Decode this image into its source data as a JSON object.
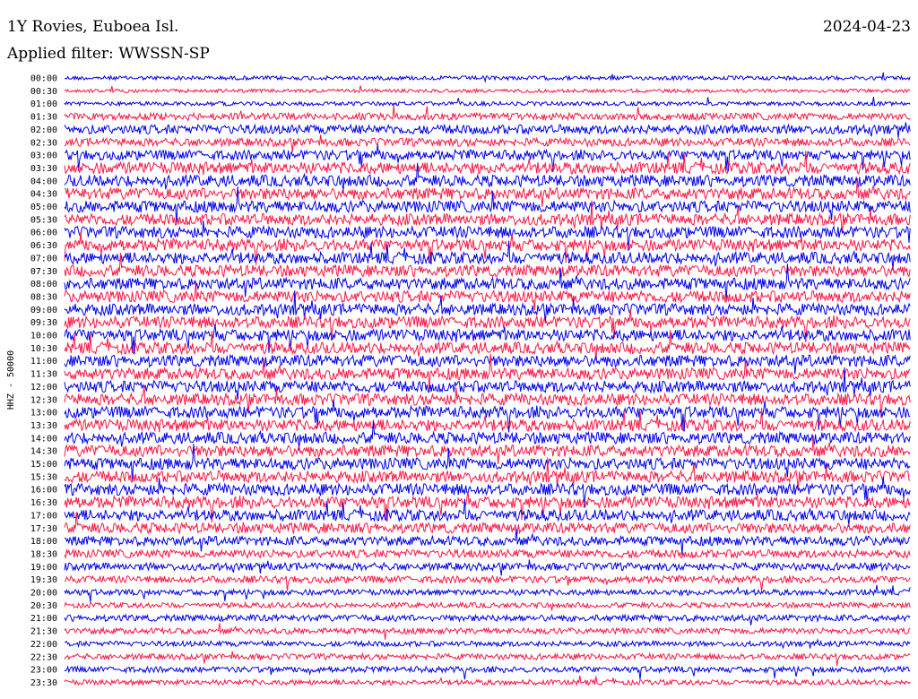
{
  "header": {
    "station": "1Y Rovies, Euboea Isl.",
    "filter": "Applied filter: WWSSN-SP",
    "date": "2024-04-23"
  },
  "chart_data": {
    "type": "line",
    "title": "1Y Rovies, Euboea Isl.",
    "subtitle": "Applied filter: WWSSN-SP",
    "date": "2024-04-23",
    "ylabel": "HHZ - 50000",
    "xlabel": "",
    "tick_labels": [
      "00:00",
      "00:30",
      "01:00",
      "01:30",
      "02:00",
      "02:30",
      "03:00",
      "03:30",
      "04:00",
      "04:30",
      "05:00",
      "05:30",
      "06:00",
      "06:30",
      "07:00",
      "07:30",
      "08:00",
      "08:30",
      "09:00",
      "09:30",
      "10:00",
      "10:30",
      "11:00",
      "11:30",
      "12:00",
      "12:30",
      "13:00",
      "13:30",
      "14:00",
      "14:30",
      "15:00",
      "15:30",
      "16:00",
      "16:30",
      "17:00",
      "17:30",
      "18:00",
      "18:30",
      "19:00",
      "19:30",
      "20:00",
      "20:30",
      "21:00",
      "21:30",
      "22:00",
      "22:30",
      "23:00",
      "23:30"
    ],
    "series_colors": [
      "#0000ee",
      "#ff1744"
    ],
    "relative_amplitude": [
      0.35,
      0.3,
      0.35,
      0.6,
      0.8,
      0.7,
      0.85,
      1.0,
      1.0,
      1.0,
      1.0,
      1.0,
      1.0,
      1.0,
      1.0,
      1.0,
      1.0,
      1.0,
      1.0,
      1.0,
      1.0,
      1.0,
      1.0,
      1.0,
      1.0,
      1.0,
      1.0,
      1.0,
      1.0,
      1.0,
      1.0,
      1.0,
      1.0,
      1.0,
      0.95,
      0.9,
      0.8,
      0.7,
      0.65,
      0.6,
      0.5,
      0.45,
      0.55,
      0.5,
      0.45,
      0.5,
      0.5,
      0.45
    ],
    "grid": false
  }
}
